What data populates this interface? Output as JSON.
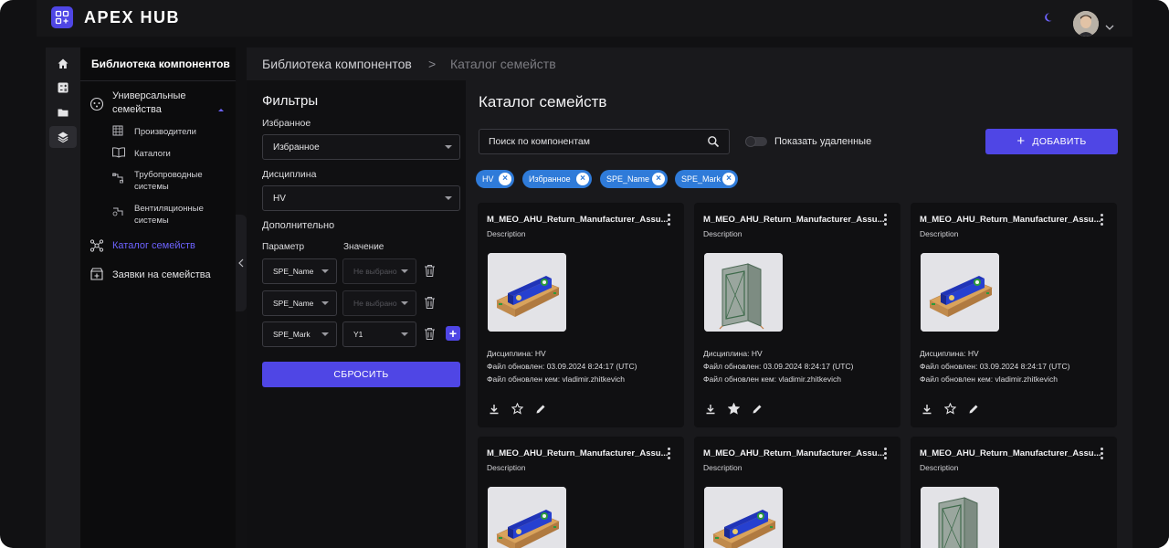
{
  "app": {
    "brand": "APEX HUB"
  },
  "nav": {
    "title": "Библиотека компонентов",
    "universal_label": "Универсальные семейства",
    "sub_items": [
      {
        "label": "Производители",
        "icon": "building-icon"
      },
      {
        "label": "Каталоги",
        "icon": "book-icon"
      },
      {
        "label": "Трубопроводные системы",
        "icon": "pipe-icon"
      },
      {
        "label": "Вентиляционные системы",
        "icon": "ventilation-icon"
      }
    ],
    "catalog_label": "Каталог семейств",
    "requests_label": "Заявки на семейства"
  },
  "breadcrumb": {
    "root": "Библиотека компонентов",
    "separator": ">",
    "current": "Каталог семейств"
  },
  "filters": {
    "title": "Фильтры",
    "favorite_label": "Избранное",
    "favorite_value": "Избранное",
    "discipline_label": "Дисциплина",
    "discipline_value": "HV",
    "additional_label": "Дополнительно",
    "param_header": "Параметр",
    "value_header": "Значение",
    "rows": [
      {
        "param": "SPE_Name",
        "value": "Не выбрано"
      },
      {
        "param": "SPE_Name",
        "value": "Не выбрано"
      },
      {
        "param": "SPE_Mark",
        "value": "Y1"
      }
    ],
    "reset_label": "СБРОСИТЬ"
  },
  "catalog": {
    "title": "Каталог семейств",
    "search_placeholder": "Поиск по компонентам",
    "toggle_label": "Показать удаленные",
    "add_label": "ДОБАВИТЬ",
    "chips": [
      "HV",
      "Избранное",
      "SPE_Name",
      "SPE_Mark"
    ],
    "cards": [
      {
        "title": "M_MEO_AHU_Return_Manufacturer_Assu...",
        "desc": "Description",
        "thumb": "ahu",
        "discipline": "Дисциплина: HV",
        "updated": "Файл обновлен: 03.09.2024 8:24:17 (UTC)",
        "updated_by": "Файл обновлен кем: vladimir.zhitkevich",
        "starred": false
      },
      {
        "title": "M_MEO_AHU_Return_Manufacturer_Assu...",
        "desc": "Description",
        "thumb": "frame",
        "discipline": "Дисциплина: HV",
        "updated": "Файл обновлен: 03.09.2024 8:24:17 (UTC)",
        "updated_by": "Файл обновлен кем: vladimir.zhitkevich",
        "starred": true
      },
      {
        "title": "M_MEO_AHU_Return_Manufacturer_Assu...",
        "desc": "Description",
        "thumb": "ahu",
        "discipline": "Дисциплина: HV",
        "updated": "Файл обновлен: 03.09.2024 8:24:17 (UTC)",
        "updated_by": "Файл обновлен кем: vladimir.zhitkevich",
        "starred": false
      },
      {
        "title": "M_MEO_AHU_Return_Manufacturer_Assu...",
        "desc": "Description",
        "thumb": "ahu",
        "discipline": "",
        "updated": "",
        "updated_by": "",
        "starred": false
      },
      {
        "title": "M_MEO_AHU_Return_Manufacturer_Assu...",
        "desc": "Description",
        "thumb": "ahu",
        "discipline": "",
        "updated": "",
        "updated_by": "",
        "starred": false
      },
      {
        "title": "M_MEO_AHU_Return_Manufacturer_Assu...",
        "desc": "Description",
        "thumb": "frame",
        "discipline": "",
        "updated": "",
        "updated_by": "",
        "starred": false
      }
    ]
  },
  "colors": {
    "accent": "#4f46e5",
    "chip": "#2f7bd9",
    "active_nav": "#6d63ff"
  }
}
